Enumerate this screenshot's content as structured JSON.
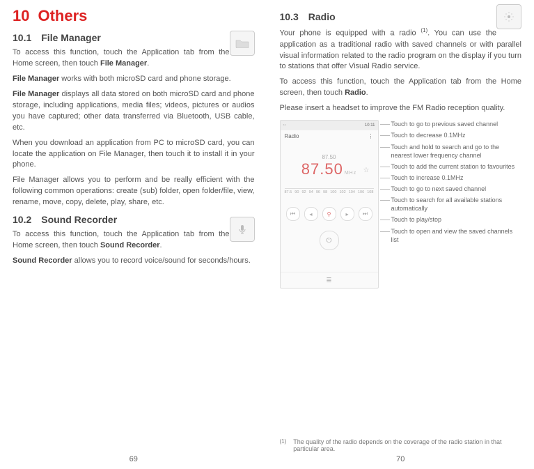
{
  "left": {
    "chapter_num": "10",
    "chapter_title": "Others",
    "s1_num": "10.1",
    "s1_title": "File Manager",
    "s1_p1a": "To access this function, touch the Application tab from the Home screen, then touch ",
    "s1_p1b": "File Manager",
    "s1_p1c": ".",
    "s1_p2a": "File Manager",
    "s1_p2b": " works with both microSD card and phone storage.",
    "s1_p3a": "File Manager",
    "s1_p3b": " displays all data stored on both microSD card and phone storage, including applications, media files; videos, pictures or audios you have captured; other data transferred via Bluetooth, USB cable, etc.",
    "s1_p4": "When you download an application from PC to microSD card, you can locate the application on File Manager, then touch it to install it in your phone.",
    "s1_p5": "File Manager allows you to perform and be really efficient with the following common operations: create (sub) folder, open folder/file, view, rename, move, copy, delete, play, share, etc.",
    "s2_num": "10.2",
    "s2_title": "Sound Recorder",
    "s2_p1a": "To access this function, touch the Application tab from the Home screen, then touch ",
    "s2_p1b": "Sound Recorder",
    "s2_p1c": ".",
    "s2_p2a": "Sound Recorder",
    "s2_p2b": " allows you to record voice/sound for seconds/hours.",
    "pagenum": "69"
  },
  "right": {
    "s3_num": "10.3",
    "s3_title": "Radio",
    "s3_p1": "Your phone is equipped with a radio (1). You can use the application as a traditional radio with saved channels or with parallel visual information related to the radio program on the display if you turn to stations that offer Visual Radio service.",
    "s3_p2a": "To access this function, touch the Application tab from the Home screen, then touch ",
    "s3_p2b": "Radio",
    "s3_p2c": ".",
    "s3_p3": "Please insert a headset to improve the FM Radio reception quality.",
    "phone": {
      "time": "10:11",
      "title": "Radio",
      "freq_small": "87.50",
      "freq_big": "87.50",
      "mhz": "MHz",
      "dial": [
        "87.5",
        "90",
        "92",
        "94",
        "96",
        "98",
        "100",
        "102",
        "104",
        "106",
        "108"
      ]
    },
    "callouts": {
      "c1": "Touch to go to previous saved channel",
      "c2": "Touch to decrease 0.1MHz",
      "c3": "Touch and hold to search and go to the nearest lower frequency channel",
      "c4": "Touch to add the current station to favourites",
      "c5": "Touch to increase 0.1MHz",
      "c6": "Touch to go to next saved channel",
      "c7": "Touch to search for all available stations automatically",
      "c8": "Touch to play/stop",
      "c9": "Touch to open and view the saved channels list"
    },
    "footnote_sup": "(1)",
    "footnote": "The quality of the radio depends on the coverage of the radio station in that particular area.",
    "pagenum": "70"
  }
}
